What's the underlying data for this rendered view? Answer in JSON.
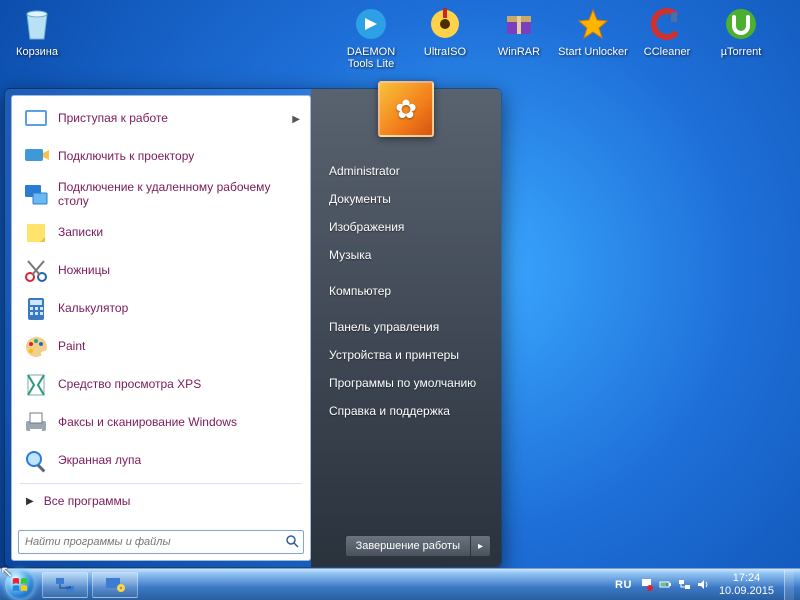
{
  "desktop_icons": [
    {
      "name": "recycle-bin",
      "label": "Корзина"
    },
    {
      "name": "daemon-tools",
      "label": "DAEMON Tools Lite"
    },
    {
      "name": "ultraiso",
      "label": "UltraISO"
    },
    {
      "name": "winrar",
      "label": "WinRAR"
    },
    {
      "name": "start-unlocker",
      "label": "Start Unlocker"
    },
    {
      "name": "ccleaner",
      "label": "CCleaner"
    },
    {
      "name": "utorrent",
      "label": "µTorrent"
    }
  ],
  "start_menu": {
    "programs": [
      {
        "name": "getting-started",
        "label": "Приступая к работе",
        "has_submenu": true
      },
      {
        "name": "connect-projector",
        "label": "Подключить к проектору"
      },
      {
        "name": "remote-desktop",
        "label": "Подключение к удаленному рабочему столу"
      },
      {
        "name": "sticky-notes",
        "label": "Записки"
      },
      {
        "name": "snipping-tool",
        "label": "Ножницы"
      },
      {
        "name": "calculator",
        "label": "Калькулятор"
      },
      {
        "name": "paint",
        "label": "Paint"
      },
      {
        "name": "xps-viewer",
        "label": "Средство просмотра XPS"
      },
      {
        "name": "fax-scan",
        "label": "Факсы и сканирование Windows"
      },
      {
        "name": "magnifier",
        "label": "Экранная лупа"
      }
    ],
    "all_programs_label": "Все программы",
    "search_placeholder": "Найти программы и файлы",
    "right_links": [
      "Administrator",
      "Документы",
      "Изображения",
      "Музыка",
      "Компьютер",
      "Панель управления",
      "Устройства и принтеры",
      "Программы по умолчанию",
      "Справка и поддержка"
    ],
    "shutdown_label": "Завершение работы"
  },
  "taskbar": {
    "language": "RU",
    "time": "17:24",
    "date": "10.09.2015"
  },
  "colors": {
    "program_text": "#7a1a5a"
  }
}
